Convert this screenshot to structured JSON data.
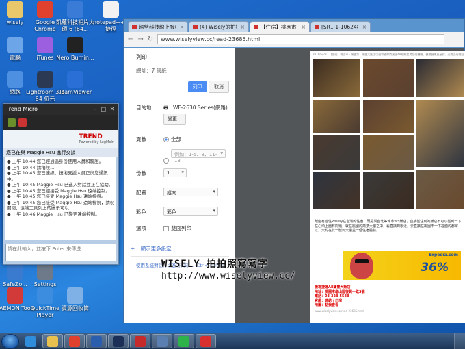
{
  "desktop_icons": [
    {
      "label": "wisely",
      "icon": "folder-user-icon",
      "color": "#e8c86a"
    },
    {
      "label": "Google Chrome",
      "icon": "chrome-icon",
      "color": "#e0412f"
    },
    {
      "label": "凱蘿科技相片大師 6 (64...",
      "icon": "photo-app-icon",
      "color": "#3b7bd8"
    },
    {
      "label": "notepad++ - 捷徑",
      "icon": "notepad-icon",
      "color": "#f2f2f2"
    },
    {
      "label": "電腦",
      "icon": "computer-icon",
      "color": "#6ca6e8"
    },
    {
      "label": "iTunes",
      "icon": "itunes-icon",
      "color": "#9b5fe0"
    },
    {
      "label": "Nero Burnin...",
      "icon": "nero-icon",
      "color": "#222222"
    },
    {
      "label": "網路",
      "icon": "network-icon",
      "color": "#4d8fe0"
    },
    {
      "label": "Lightroom 3.3 64 位元",
      "icon": "lightroom-icon",
      "color": "#2b3a52"
    },
    {
      "label": "TeamViewer",
      "icon": "teamviewer-icon",
      "color": "#2a6fd6"
    },
    {
      "label": "SafeZo...",
      "icon": "safezone-icon",
      "color": "#3a7bd0"
    },
    {
      "label": "Settings",
      "icon": "settings-icon",
      "color": "#6e7a8a"
    },
    {
      "label": "DAEMON Tools",
      "icon": "daemon-tools-icon",
      "color": "#d23a3a"
    },
    {
      "label": "QuickTime Player",
      "icon": "quicktime-icon",
      "color": "#3c8de0"
    },
    {
      "label": "資源回收筒",
      "icon": "recycle-bin-icon",
      "color": "#7fb0e6"
    }
  ],
  "trend": {
    "title": "Trend Micro",
    "logo": "TREND",
    "logo_sub": "Powered by LogMeIn",
    "subtitle": "您已在與 Maggie Hsu 進行交談",
    "log": [
      "上午 10:44 您已經通過身份使用人員和驗證。",
      "上午 10:44 請稍候...",
      "上午 10:45 您已連線，技術支援人員正與您通訊中。",
      "上午 10:45 Maggie Hsu 已進入對話並正在協助。",
      "上午 10:45 您已經接受 Maggie Hsu 遠端控制。",
      "上午 10:45 您已接受 Maggie Hsu 遠端檢視。",
      "上午 10:45 您已接受 Maggie Hsu 遠端檢視，請勿關閉，遠端工具列上的圖示可以...",
      "上午 10:46 Maggie Hsu 已變更遠端控制。"
    ],
    "input_placeholder": "請在此輸入，並按下 Enter 來傳送"
  },
  "chrome": {
    "tabs": [
      {
        "label": "趨勢科技線上服務",
        "active": false
      },
      {
        "label": "(4) Wisely的拍拍照寫",
        "active": false
      },
      {
        "label": "【住宿】桃園市 · 蘭",
        "active": true
      },
      {
        "label": "[SR1-1-1062481425",
        "active": false
      }
    ],
    "url": "www.wiselyview.cc/read-23685.html"
  },
  "print": {
    "title": "列印",
    "total": "總計：7 張紙",
    "print_button": "列印",
    "cancel_button": "取消",
    "dest_label": "目的地",
    "dest_value": "WF-2630 Series(網路)",
    "change_button": "變更...",
    "pages_label": "頁數",
    "pages_all": "全部",
    "pages_example": "例如：1-5、8、11-13",
    "copies_label": "份數",
    "copies_value": "1",
    "layout_label": "配置",
    "layout_value": "縱向",
    "color_label": "彩色",
    "color_value": "彩色",
    "options_label": "選項",
    "options_value": "雙面列印",
    "more_settings": "顯示更多設定",
    "system_dialog": "使用系統對話方塊進行列印... (Ctrl+Shift+P)"
  },
  "preview": {
    "header_date": "2016/6/28",
    "header_text": "【住宿】桃園市 · 蘭豐第：蘭豐大飯店以道和國際商業區A8總統套房住宿體驗，機場捷運直接到、近桃園高鐵站",
    "body_text": "飯店有連住Wisely在台灣的住宿，而是與台北等城市WS飯店，直接從住到的飯店不可以從到一下在心頭上面有問題，就在桃園的商業大樓之中，看直接到很近。去直接在桃園市一下裡面的都可以，大約在此一號到大樓並一個住宿體驗。",
    "info_title": "機場捷運A8蘭豐大飯店",
    "info_address": "地址：桃園市龜山區復興一路2號",
    "info_phone": "電話：03-328-5588",
    "info_site": "官網：連結 / 訂房",
    "info_map": "地圖：點我查看",
    "footer_url": "www.wiselyview.cc/read-23685.html",
    "ad_brand": "Expedia.com",
    "ad_percent": "36%"
  },
  "watermark": {
    "line1": "WISELY 拍拍照寫寫字",
    "line2": "http://www.wiselyview.cc/"
  },
  "taskbar": [
    {
      "icon": "internet-explorer-icon",
      "color": "#2f8ddb"
    },
    {
      "icon": "file-explorer-icon",
      "color": "#e8c050"
    },
    {
      "icon": "chrome-icon",
      "color": "#e0412f"
    },
    {
      "icon": "word-icon",
      "color": "#2b5fad"
    },
    {
      "icon": "photoshop-icon",
      "color": "#1c2f57"
    },
    {
      "icon": "trend-micro-icon",
      "color": "#c62b2b"
    },
    {
      "icon": "photo-app-icon",
      "color": "#5a7fb0"
    },
    {
      "icon": "line-icon",
      "color": "#2eb34a"
    },
    {
      "icon": "logmein-icon",
      "color": "#d83030"
    }
  ]
}
